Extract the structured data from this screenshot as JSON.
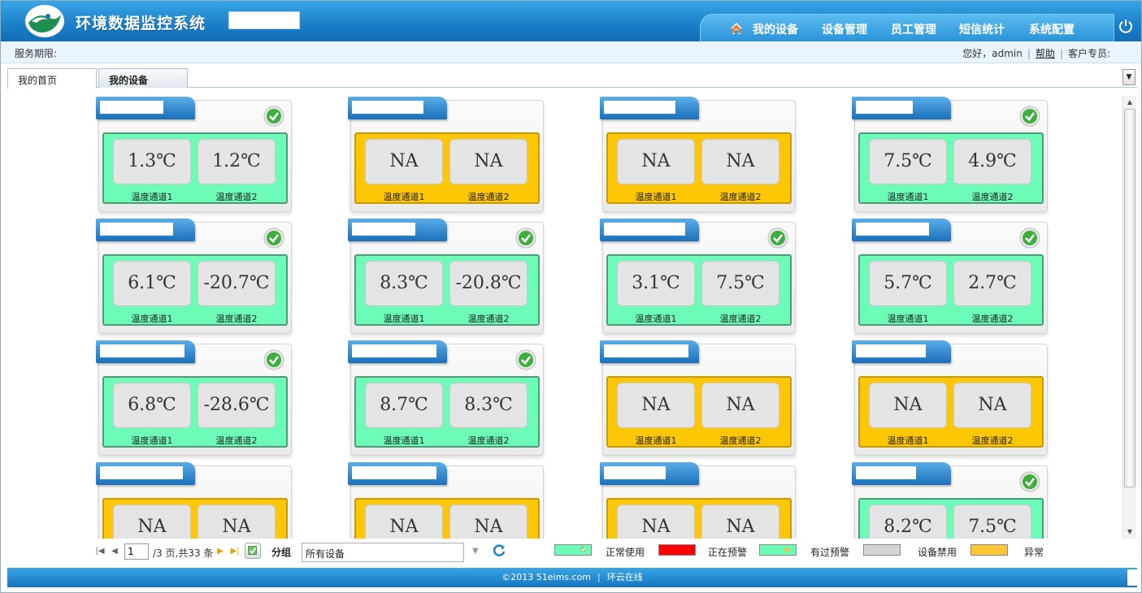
{
  "header": {
    "app_title": "环境数据监控系统",
    "nav": [
      "我的设备",
      "设备管理",
      "员工管理",
      "短信统计",
      "系统配置"
    ]
  },
  "subbar": {
    "service_label": "服务期限:",
    "greeting": "您好，admin",
    "help": "帮助",
    "support": "客户专员:"
  },
  "tabs": [
    "我的首页",
    "我的设备"
  ],
  "devices": [
    {
      "status": "normal",
      "ok": true,
      "ch1": "1.3℃",
      "ch2": "1.2℃"
    },
    {
      "status": "abnormal",
      "ok": false,
      "ch1": "NA",
      "ch2": "NA"
    },
    {
      "status": "abnormal",
      "ok": false,
      "ch1": "NA",
      "ch2": "NA"
    },
    {
      "status": "normal",
      "ok": true,
      "ch1": "7.5℃",
      "ch2": "4.9℃"
    },
    {
      "status": "normal",
      "ok": true,
      "ch1": "6.1℃",
      "ch2": "-20.7℃"
    },
    {
      "status": "normal",
      "ok": true,
      "ch1": "8.3℃",
      "ch2": "-20.8℃"
    },
    {
      "status": "normal",
      "ok": true,
      "ch1": "3.1℃",
      "ch2": "7.5℃"
    },
    {
      "status": "normal",
      "ok": true,
      "ch1": "5.7℃",
      "ch2": "2.7℃"
    },
    {
      "status": "normal",
      "ok": true,
      "ch1": "6.8℃",
      "ch2": "-28.6℃"
    },
    {
      "status": "normal",
      "ok": true,
      "ch1": "8.7℃",
      "ch2": "8.3℃"
    },
    {
      "status": "abnormal",
      "ok": false,
      "ch1": "NA",
      "ch2": "NA"
    },
    {
      "status": "abnormal",
      "ok": false,
      "ch1": "NA",
      "ch2": "NA"
    },
    {
      "status": "abnormal",
      "ok": false,
      "ch1": "NA",
      "ch2": "NA"
    },
    {
      "status": "abnormal",
      "ok": false,
      "ch1": "NA",
      "ch2": "NA"
    },
    {
      "status": "abnormal",
      "ok": false,
      "ch1": "NA",
      "ch2": "NA"
    },
    {
      "status": "normal",
      "ok": true,
      "ch1": "8.2℃",
      "ch2": "7.5℃"
    }
  ],
  "channel_labels": [
    "温度通道1",
    "温度通道2"
  ],
  "pager": {
    "page_value": "1",
    "page_info": "/3 页,共33 条",
    "group_label": "分组",
    "group_value": "所有设备"
  },
  "legend": [
    {
      "label": "正常使用",
      "color": "#6cfcb8"
    },
    {
      "label": "正在预警",
      "color": "#ff0000"
    },
    {
      "label": "有过预警",
      "color": "#6cfcb8"
    },
    {
      "label": "设备禁用",
      "color": "#d4d4d4"
    },
    {
      "label": "异常",
      "color": "#fec735"
    }
  ],
  "footer": {
    "copyright": "©2013 51eims.com",
    "brand": "环云在线"
  }
}
